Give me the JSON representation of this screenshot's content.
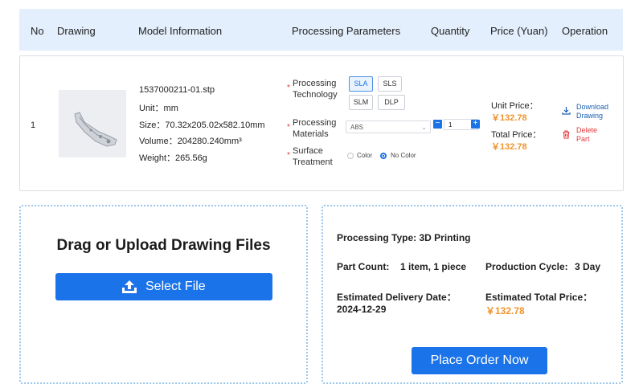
{
  "table": {
    "headers": [
      "No",
      "Drawing",
      "Model Information",
      "Processing Parameters",
      "Quantity",
      "Price (Yuan)",
      "Operation"
    ],
    "row": {
      "no": "1",
      "file_name": "1537000211-01.stp",
      "unit": "Unit：mm",
      "size": "Size：70.32x205.02x582.10mm",
      "volume": "Volume：204280.240mm³",
      "weight": "Weight：265.56g",
      "processing_technology_label": [
        "Processing",
        "Technology"
      ],
      "technologies": [
        "SLA",
        "SLS",
        "SLM",
        "DLP"
      ],
      "selected_technology": "SLA",
      "processing_materials_label": [
        "Processing",
        "Materials"
      ],
      "material": "ABS",
      "quantity": "1",
      "surface_treatment_label": [
        "Surface",
        "Treatment"
      ],
      "surface_options": [
        "Color",
        "No Color"
      ],
      "selected_surface": "No Color",
      "unit_price_label": "Unit Price：",
      "unit_price": "￥132.78",
      "total_price_label": "Total Price：",
      "total_price": "￥132.78",
      "download_label": [
        "Download",
        "Drawing"
      ],
      "delete_label": [
        "Delete",
        "Part"
      ]
    }
  },
  "upload": {
    "title": "Drag or Upload Drawing Files",
    "button_label": "Select File"
  },
  "summary": {
    "processing_type": "Processing Type: 3D Printing",
    "part_count_label": "Part Count:",
    "part_count_value": "1 item, 1 piece",
    "production_cycle_label": "Production Cycle:",
    "production_cycle_value": "3 Day",
    "delivery_label": "Estimated Delivery Date：",
    "delivery_value": "2024-12-29",
    "total_label": "Estimated Total Price：",
    "total_value": "￥132.78",
    "order_button": "Place Order Now"
  },
  "colors": {
    "accent": "#1a73e8",
    "price": "#f0932b",
    "danger": "#e5383b",
    "header_bg": "#e3effc"
  }
}
